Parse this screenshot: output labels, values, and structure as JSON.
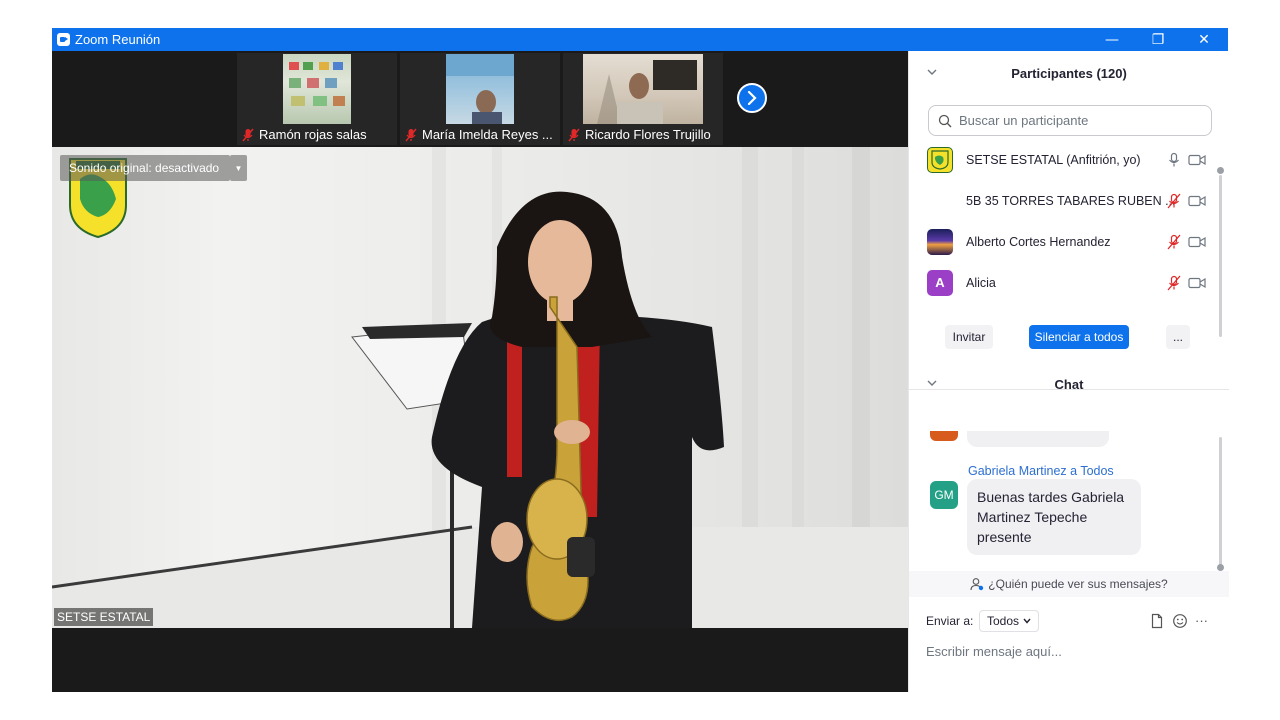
{
  "window": {
    "title": "Zoom Reunión",
    "minimize_glyph": "—",
    "restore_glyph": "❐",
    "close_glyph": "✕"
  },
  "thumbnails": [
    {
      "name": "Ramón rojas salas",
      "mic": "muted"
    },
    {
      "name": "María Imelda Reyes ...",
      "mic": "muted"
    },
    {
      "name": "Ricardo Flores Trujillo",
      "mic": "muted"
    }
  ],
  "main_video": {
    "original_sound": "Sonido original: desactivado",
    "speaker_name": "SETSE ESTATAL"
  },
  "participants": {
    "header": "Participantes (120)",
    "search_placeholder": "Buscar un participante",
    "list": [
      {
        "name": "SETSE ESTATAL (Anfitrión, yo)",
        "avatar": "logo",
        "mic": "on",
        "video": "off"
      },
      {
        "name": "5B 35 TORRES TABARES RUBEN ...",
        "avatar": "none",
        "mic": "muted",
        "video": "off"
      },
      {
        "name": "Alberto Cortes Hernandez",
        "avatar": "photo",
        "mic": "muted",
        "video": "off"
      },
      {
        "name": "Alicia",
        "avatar": "A",
        "avatar_color": "#9b3fc7",
        "mic": "muted",
        "video": "off"
      }
    ],
    "invite_label": "Invitar",
    "mute_all_label": "Silenciar a todos",
    "more_label": "..."
  },
  "chat": {
    "header": "Chat",
    "messages": [
      {
        "sender": "Gabriela Martinez a Todos",
        "initials": "GM",
        "text": "Buenas tardes Gabriela Martinez Tepeche presente"
      }
    ],
    "who_sees": "¿Quién puede ver sus mensajes?",
    "send_to_label": "Enviar a:",
    "send_to_value": "Todos",
    "input_placeholder": "Escribir mensaje aquí...",
    "more_glyph": "···"
  },
  "colors": {
    "accent": "#0e72ed",
    "muted_red": "#e02828"
  }
}
